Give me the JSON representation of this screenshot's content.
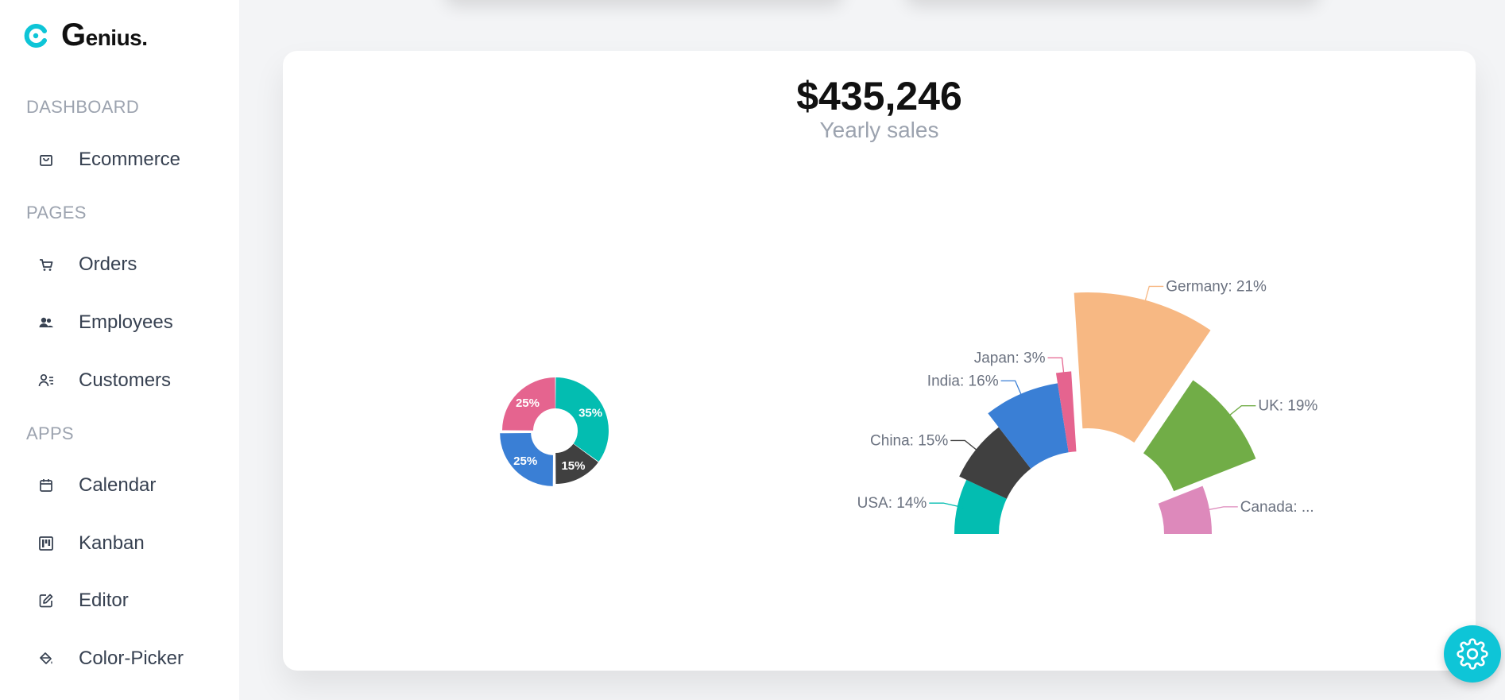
{
  "app": {
    "name": "enius.",
    "name_initial": "G",
    "brand_color": "#0ec5d7"
  },
  "sidebar": {
    "sections": [
      {
        "title": "DASHBOARD",
        "items": [
          {
            "label": "Ecommerce",
            "icon": "shopping-bag-icon"
          }
        ]
      },
      {
        "title": "PAGES",
        "items": [
          {
            "label": "Orders",
            "icon": "cart-icon"
          },
          {
            "label": "Employees",
            "icon": "users-icon"
          },
          {
            "label": "Customers",
            "icon": "user-list-icon"
          }
        ]
      },
      {
        "title": "APPS",
        "items": [
          {
            "label": "Calendar",
            "icon": "calendar-icon"
          },
          {
            "label": "Kanban",
            "icon": "kanban-icon"
          },
          {
            "label": "Editor",
            "icon": "edit-icon"
          },
          {
            "label": "Color-Picker",
            "icon": "paint-bucket-icon"
          }
        ]
      }
    ]
  },
  "card": {
    "amount": "$435,246",
    "label": "Yearly sales"
  },
  "settings": {
    "icon": "gear-icon"
  },
  "chart_data": [
    {
      "type": "pie",
      "subtype": "donut",
      "slices": [
        {
          "label": "35%",
          "value": 35,
          "color": "#03bdb1"
        },
        {
          "label": "15%",
          "value": 15,
          "color": "#404040"
        },
        {
          "label": "25%",
          "value": 25,
          "color": "#3a7fd5"
        },
        {
          "label": "25%",
          "value": 25,
          "color": "#e5648f"
        }
      ]
    },
    {
      "type": "pie",
      "subtype": "semi-donut",
      "slices": [
        {
          "label": "USA: 14%",
          "value": 14,
          "color": "#03bdb1"
        },
        {
          "label": "China: 15%",
          "value": 15,
          "color": "#404040"
        },
        {
          "label": "India: 16%",
          "value": 16,
          "color": "#3a7fd5"
        },
        {
          "label": "Japan: 3%",
          "value": 3,
          "color": "#e5648f"
        },
        {
          "label": "Germany: 21%",
          "value": 21,
          "color": "#f7b883"
        },
        {
          "label": "UK: 19%",
          "value": 19,
          "color": "#71ad47"
        },
        {
          "label": "Canada: ...",
          "value": 12,
          "color": "#dd89bb"
        }
      ]
    }
  ]
}
